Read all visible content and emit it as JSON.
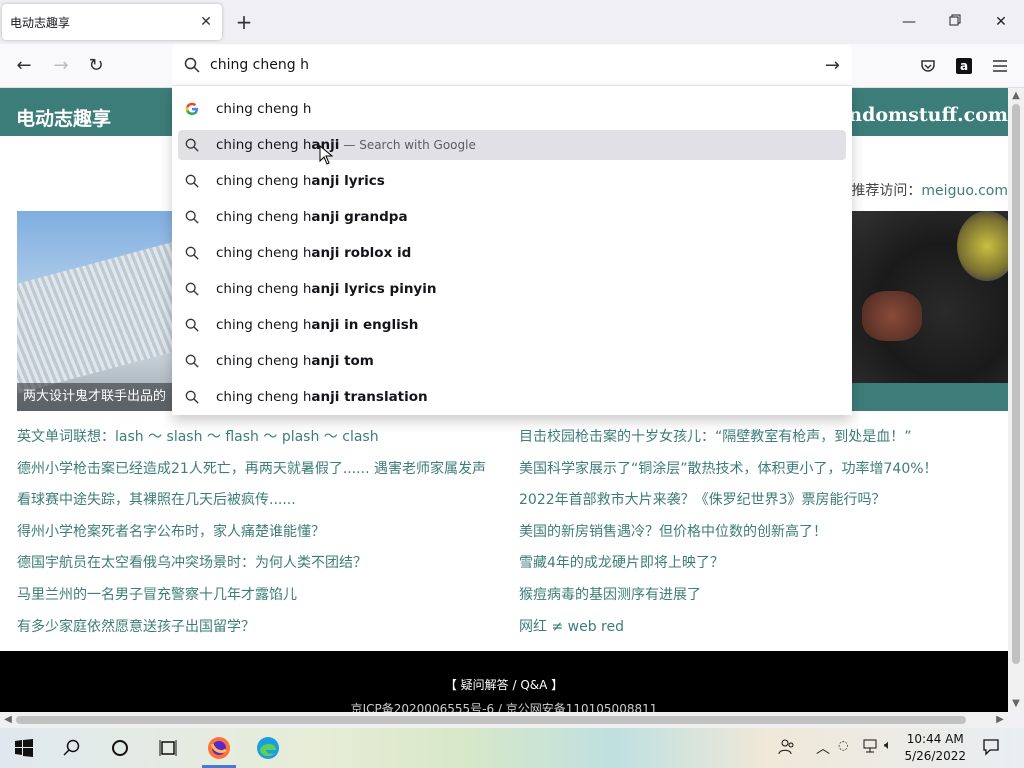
{
  "tab": {
    "title": "电动志趣享"
  },
  "urlbar": {
    "query": "ching cheng h"
  },
  "suggestions": [
    {
      "prefix": "ching cheng h",
      "bold": "",
      "suffix": "",
      "icon": "google-icon"
    },
    {
      "prefix": "ching cheng h",
      "bold": "anji",
      "suffix": "— Search with Google",
      "icon": "search-icon",
      "highlighted": true
    },
    {
      "prefix": "ching cheng h",
      "bold": "anji lyrics",
      "suffix": "",
      "icon": "search-icon"
    },
    {
      "prefix": "ching cheng h",
      "bold": "anji grandpa",
      "suffix": "",
      "icon": "search-icon"
    },
    {
      "prefix": "ching cheng h",
      "bold": "anji roblox id",
      "suffix": "",
      "icon": "search-icon"
    },
    {
      "prefix": "ching cheng h",
      "bold": "anji lyrics pinyin",
      "suffix": "",
      "icon": "search-icon"
    },
    {
      "prefix": "ching cheng h",
      "bold": "anji in english",
      "suffix": "",
      "icon": "search-icon"
    },
    {
      "prefix": "ching cheng h",
      "bold": "anji tom",
      "suffix": "",
      "icon": "search-icon"
    },
    {
      "prefix": "ching cheng h",
      "bold": "anji translation",
      "suffix": "",
      "icon": "search-icon"
    }
  ],
  "site": {
    "brand": "电动志趣享",
    "domain": "randomstuff.com",
    "recommend_label": "？ 推荐访问：",
    "recommend_link": "meiguo.com",
    "left_caption": "两大设计鬼才联手出品的",
    "accent_color": "#3d7d79"
  },
  "news_left": [
    "英文单词联想：lash ～ slash ～ flash ～ plash ～ clash",
    "德州小学枪击案已经造成21人死亡，再两天就暑假了...... 遇害老师家属发声",
    "看球赛中途失踪，其裸照在几天后被疯传......",
    "得州小学枪案死者名字公布时，家人痛楚谁能懂？",
    "德国宇航员在太空看俄乌冲突场景时：为何人类不团结？",
    "马里兰州的一名男子冒充警察十几年才露馅儿",
    "有多少家庭依然愿意送孩子出国留学？"
  ],
  "news_right": [
    "目击校园枪击案的十岁女孩儿：“隔壁教室有枪声，到处是血！”",
    "美国科学家展示了“铜涂层”散热技术，体积更小了，功率增740%！",
    "2022年首部救市大片来袭？《侏罗纪世界3》票房能行吗？",
    "美国的新房销售遇冷？但价格中位数的创新高了！",
    "雪藏4年的成龙硬片即将上映了？",
    "猴痘病毒的基因测序有进展了",
    "网红 ≠ web red"
  ],
  "footer": {
    "qa": "【 疑问解答 / Q&A 】",
    "icp": "京ICP备2020006555号-6 / 京公网安备110105008811"
  },
  "taskbar": {
    "time": "10:44 AM",
    "date": "5/26/2022"
  }
}
